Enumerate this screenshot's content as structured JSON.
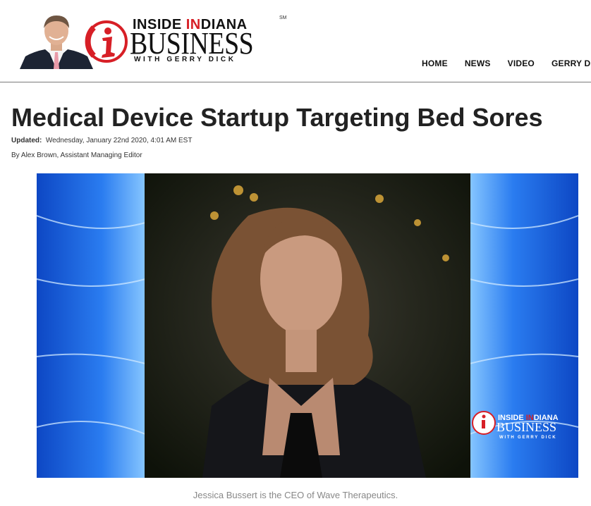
{
  "header": {
    "brand_top_prefix": "INSIDE ",
    "brand_top_red": "IN",
    "brand_top_suffix": "DIANA",
    "brand_main": "BUSINESS",
    "brand_sub": "WITH GERRY DICK",
    "trademark": "SM",
    "nav": [
      "HOME",
      "NEWS",
      "VIDEO",
      "GERRY DICK"
    ]
  },
  "article": {
    "title": "Medical Device Startup Targeting Bed Sores",
    "updated_label": "Updated:",
    "updated_value": "Wednesday, January 22nd 2020, 4:01 AM EST",
    "byline": "By Alex Brown, Assistant Managing Editor",
    "caption": "Jessica Bussert is the CEO of Wave Therapeutics."
  },
  "watermark": {
    "top_prefix": "INSIDE ",
    "top_red": "IN",
    "top_suffix": "DIANA",
    "main": "BUSINESS",
    "sub": "WITH GERRY DICK"
  },
  "colors": {
    "brand_red": "#d71f26",
    "backdrop_blue": "#1a5fd8"
  }
}
